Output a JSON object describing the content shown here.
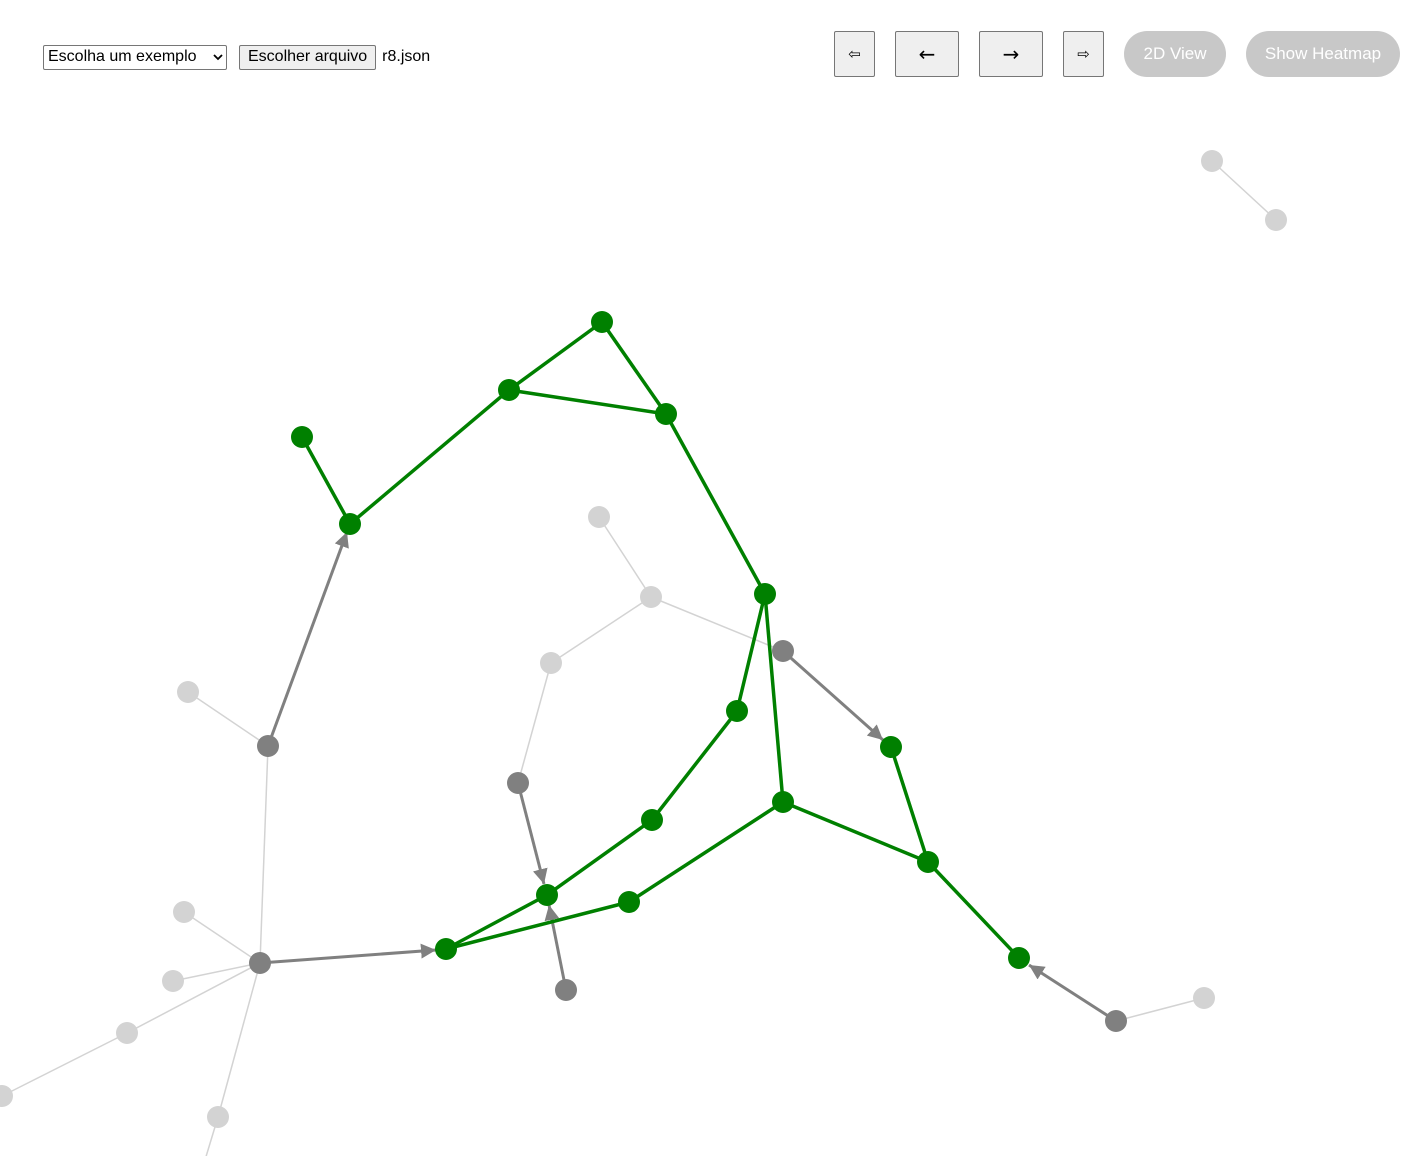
{
  "toolbar": {
    "example_select": {
      "selected": "Escolha um exemplo"
    },
    "file_button_label": "Escolher arquivo",
    "file_name": "r8.json",
    "nav": {
      "first": "⇦",
      "prev": "←",
      "next": "→",
      "last": "⇨"
    },
    "view_button_label": "2D View",
    "heatmap_button_label": "Show Heatmap"
  },
  "colors": {
    "path": "#008000",
    "visited": "#808080",
    "inactive": "#d3d3d3",
    "pill_button": "#c8c8c8"
  }
}
